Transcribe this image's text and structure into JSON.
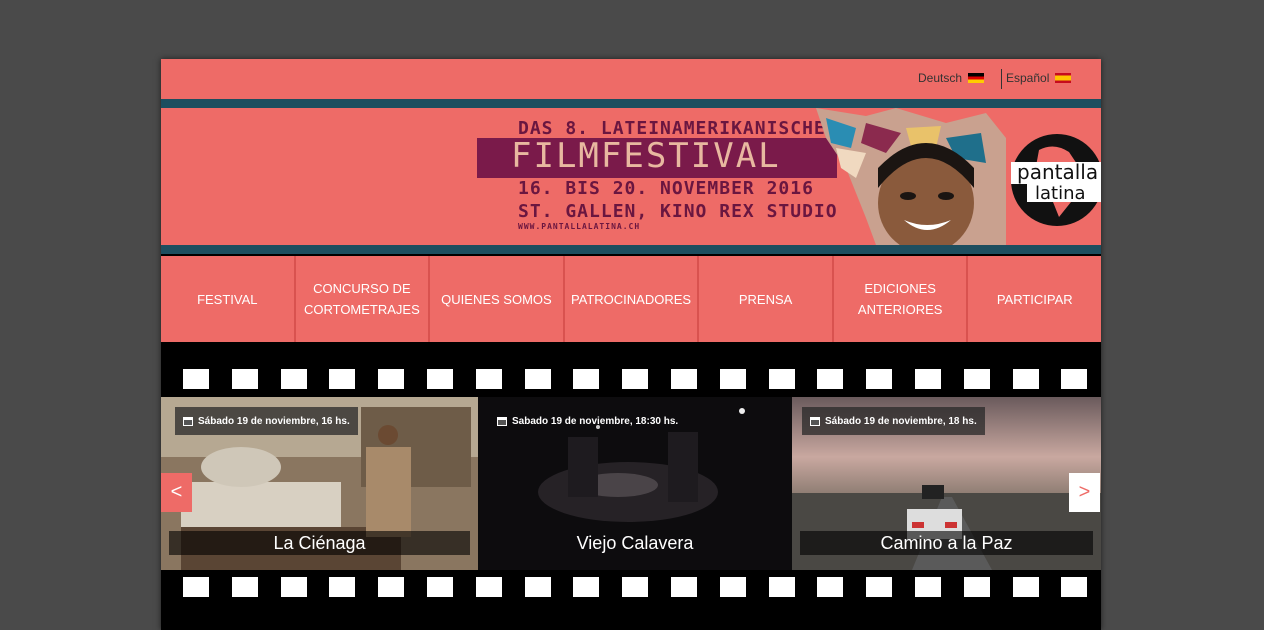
{
  "lang": {
    "deutsch": "Deutsch",
    "espanol": "Español"
  },
  "banner": {
    "line1": "DAS 8. LATEINAMERIKANISCHE",
    "festival": "FILMFESTIVAL",
    "dates": "16. BIS 20. NOVEMBER 2016",
    "venue": "ST. GALLEN, KINO REX STUDIO",
    "url": "WWW.PANTALLALATINA.CH",
    "logo_line1": "pantalla",
    "logo_line2": "latina"
  },
  "nav": {
    "items": [
      "FESTIVAL",
      "CONCURSO DE CORTOMETRAJES",
      "QUIENES SOMOS",
      "PATROCINADORES",
      "PRENSA",
      "EDICIONES ANTERIORES",
      "PARTICIPAR"
    ]
  },
  "slides": [
    {
      "date": "Sábado 19 de noviembre, 16 hs.",
      "title": "La Ciénaga"
    },
    {
      "date": "Sabado 19 de noviembre, 18:30 hs.",
      "title": "Viejo Calavera"
    },
    {
      "date": "Sábado 19 de noviembre, 18 hs.",
      "title": "Camino a la Paz"
    }
  ],
  "arrows": {
    "prev": "<",
    "next": ">"
  },
  "colors": {
    "coral": "#ee6b67",
    "teal_stripe": "#1d4e5f",
    "background": "#4a4a4a"
  }
}
